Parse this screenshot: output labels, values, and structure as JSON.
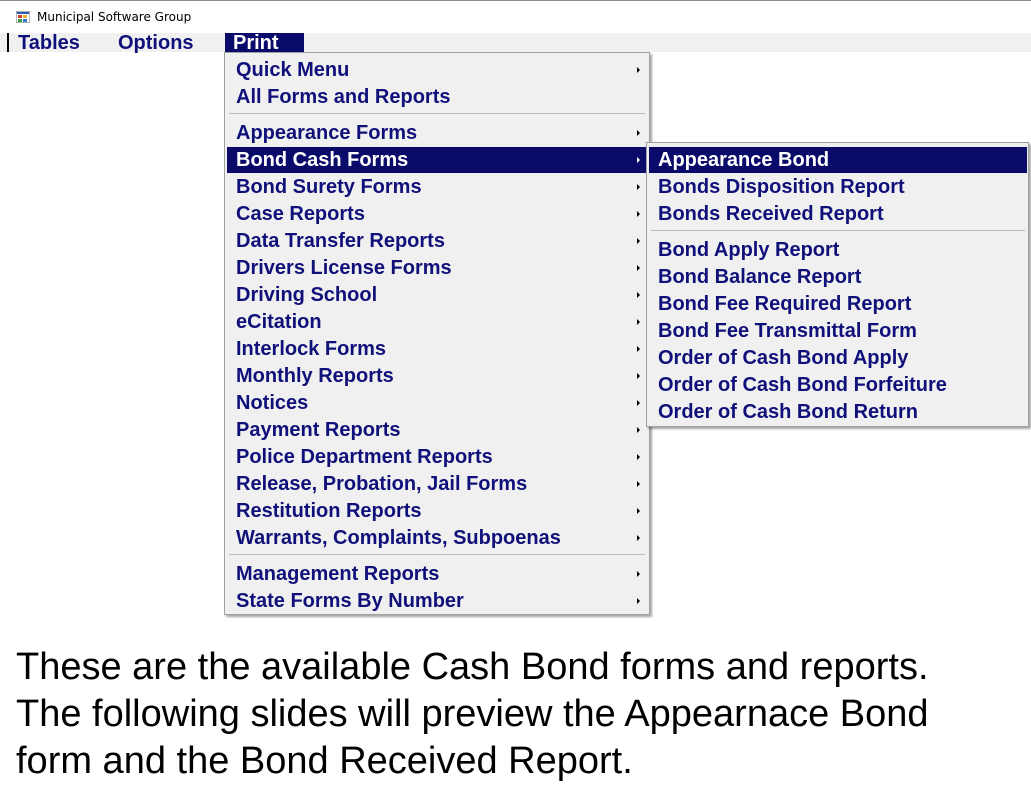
{
  "window": {
    "title": "Municipal Software Group",
    "icon": "app-windows-icon"
  },
  "menubar": {
    "items": [
      {
        "label": "Tables"
      },
      {
        "label": "Options"
      },
      {
        "label": "Print",
        "active": true
      }
    ]
  },
  "print_menu": {
    "items": [
      {
        "label": "Quick Menu",
        "has_submenu": true
      },
      {
        "label": "All Forms and Reports",
        "has_submenu": false
      },
      {
        "label": "Appearance Forms",
        "has_submenu": true
      },
      {
        "label": "Bond Cash Forms",
        "has_submenu": true,
        "selected": true
      },
      {
        "label": "Bond Surety Forms",
        "has_submenu": true
      },
      {
        "label": "Case Reports",
        "has_submenu": true
      },
      {
        "label": "Data Transfer Reports",
        "has_submenu": true
      },
      {
        "label": "Drivers License Forms",
        "has_submenu": true
      },
      {
        "label": "Driving School",
        "has_submenu": true
      },
      {
        "label": "eCitation",
        "has_submenu": true
      },
      {
        "label": "Interlock Forms",
        "has_submenu": true
      },
      {
        "label": "Monthly Reports",
        "has_submenu": true
      },
      {
        "label": "Notices",
        "has_submenu": true
      },
      {
        "label": "Payment Reports",
        "has_submenu": true
      },
      {
        "label": "Police Department Reports",
        "has_submenu": true
      },
      {
        "label": "Release, Probation, Jail Forms",
        "has_submenu": true
      },
      {
        "label": "Restitution Reports",
        "has_submenu": true
      },
      {
        "label": "Warrants, Complaints, Subpoenas",
        "has_submenu": true
      },
      {
        "label": "Management Reports",
        "has_submenu": true
      },
      {
        "label": "State Forms By Number",
        "has_submenu": true
      }
    ]
  },
  "bond_cash_submenu": {
    "items": [
      {
        "label": "Appearance Bond",
        "selected": true
      },
      {
        "label": "Bonds Disposition Report"
      },
      {
        "label": "Bonds Received Report"
      },
      {
        "label": "Bond Apply Report"
      },
      {
        "label": "Bond Balance Report"
      },
      {
        "label": "Bond Fee Required Report"
      },
      {
        "label": "Bond Fee Transmittal Form"
      },
      {
        "label": "Order of Cash Bond Apply"
      },
      {
        "label": "Order of Cash Bond Forfeiture"
      },
      {
        "label": "Order of Cash Bond Return"
      }
    ]
  },
  "caption": {
    "lines": [
      "These are the available Cash Bond forms and reports.",
      "The following slides will preview the Appearnace Bond",
      "form and the Bond Received Report."
    ]
  },
  "colors": {
    "menu_text": "#10107a",
    "highlight": "#0a0a6b",
    "menu_bg": "#f0f0f0"
  }
}
